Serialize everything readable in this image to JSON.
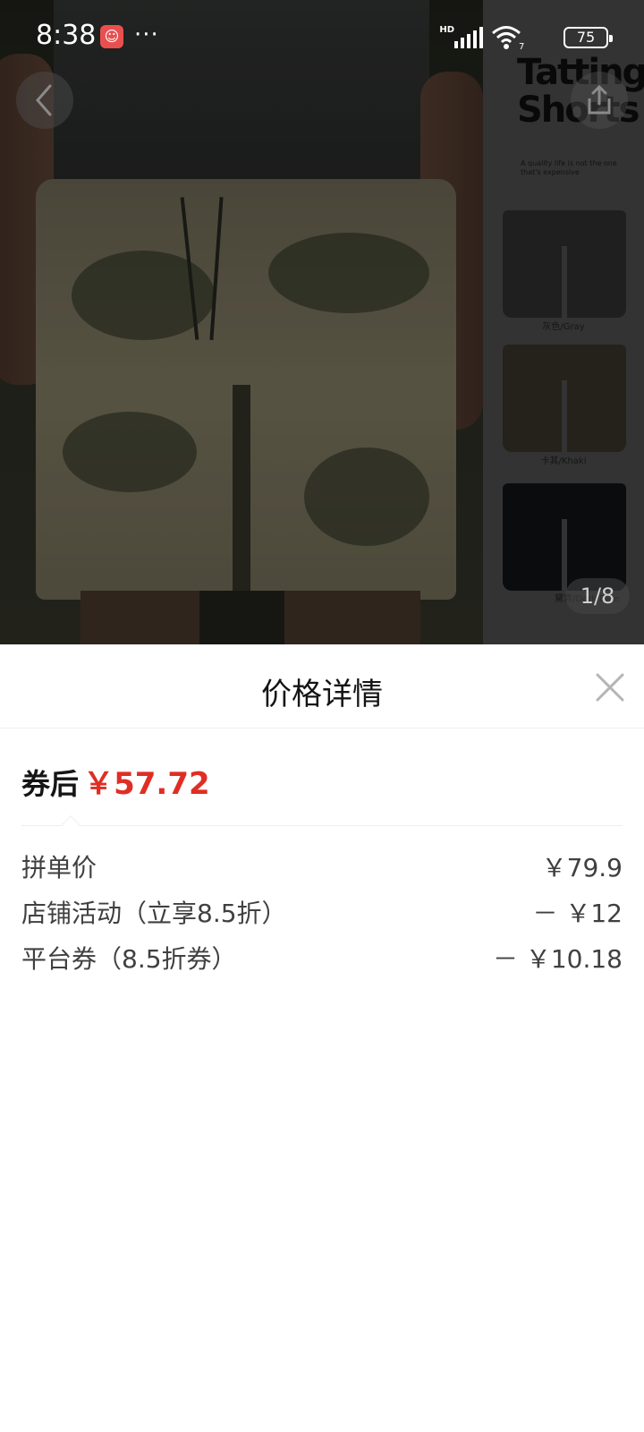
{
  "status_bar": {
    "time": "8:38",
    "network": "HD",
    "wifi_badge": "7",
    "battery": "75"
  },
  "gallery": {
    "side_title": "Tatting Shorts",
    "side_sub": "A quality life is not the one that's expensive",
    "color_labels": [
      "灰色/Gray",
      "卡其/Khaki",
      "黛青/Dark Blue"
    ],
    "page_counter": "1/8"
  },
  "sheet": {
    "title": "价格详情",
    "after_coupon_label": "券后",
    "after_coupon_price": "￥57.72",
    "rows": [
      {
        "label": "拼单价",
        "value": "￥79.9"
      },
      {
        "label": "店铺活动（立享8.5折）",
        "value": "－ ￥12"
      },
      {
        "label": "平台券（8.5折券）",
        "value": "－ ￥10.18"
      }
    ]
  },
  "colors": {
    "price_red": "#e02e24",
    "text_dark": "#151515",
    "text_mid": "#404040",
    "divider": "#eeeeee"
  },
  "icons": {
    "back": "chevron-left-icon",
    "share": "share-icon",
    "close": "close-icon",
    "signal": "signal-icon",
    "wifi": "wifi-icon",
    "battery": "battery-icon"
  }
}
